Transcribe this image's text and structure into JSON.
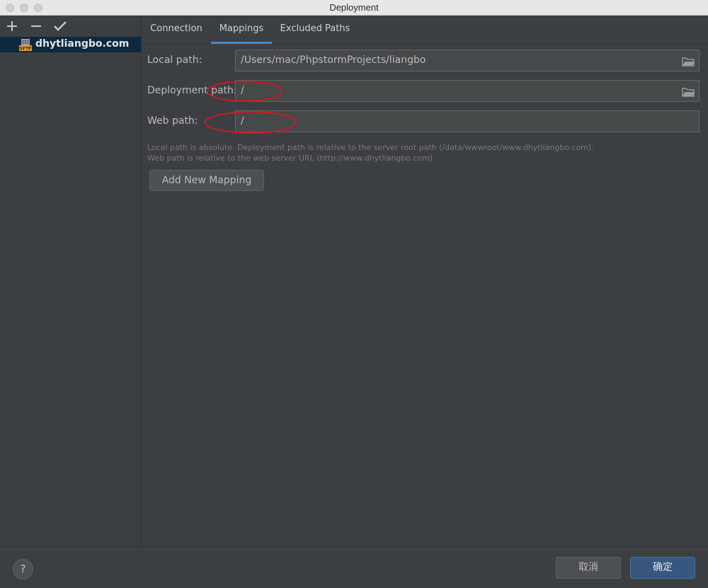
{
  "window": {
    "title": "Deployment"
  },
  "sidebar": {
    "add_icon": "plus-icon",
    "remove_icon": "minus-icon",
    "apply_icon": "check-icon",
    "servers": [
      {
        "label": "dhytliangbo.com",
        "icon": "sftp-server-icon"
      }
    ]
  },
  "tabs": [
    {
      "label": "Connection"
    },
    {
      "label": "Mappings",
      "selected": true
    },
    {
      "label": "Excluded Paths"
    }
  ],
  "mappings": {
    "local_path_label": "Local path:",
    "local_path_value": "/Users/mac/PhpstormProjects/liangbo",
    "deployment_path_label": "Deployment path:",
    "deployment_path_value": "/",
    "web_path_label": "Web path:",
    "web_path_value": "/",
    "help_line1": "Local path is absolute. Deployment path is relative to the server root path (/data/wwwroot/www.dhytliangbo.com).",
    "help_line2": "Web path is relative to the web server URL (http://www.dhytliangbo.com).",
    "add_button": "Add New Mapping"
  },
  "footer": {
    "help_label": "?",
    "cancel_label": "取消",
    "ok_label": "确定"
  },
  "colors": {
    "background": "#3c3f41",
    "selected_item": "#0d293e",
    "tab_underline": "#4a88c7",
    "annotation": "#e0121e",
    "ok_button": "#365880"
  }
}
